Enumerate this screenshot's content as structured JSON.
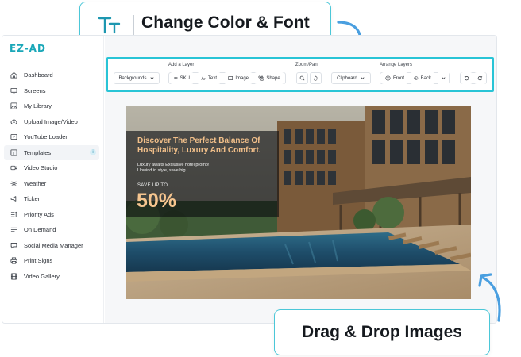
{
  "callouts": {
    "top": "Change Color & Font",
    "bottom": "Drag & Drop Images",
    "top_icon": "text-format-icon"
  },
  "app": {
    "logo": "EZ-AD",
    "brand_color": "#1aa7b8",
    "highlight_color": "#29c4d6"
  },
  "sidebar": {
    "items": [
      {
        "label": "Dashboard",
        "icon": "home-icon"
      },
      {
        "label": "Screens",
        "icon": "monitor-icon"
      },
      {
        "label": "My Library",
        "icon": "image-icon"
      },
      {
        "label": "Upload Image/Video",
        "icon": "cloud-upload-icon"
      },
      {
        "label": "YouTube Loader",
        "icon": "play-box-icon"
      },
      {
        "label": "Templates",
        "icon": "templates-icon",
        "active": true,
        "badge": "i"
      },
      {
        "label": "Video Studio",
        "icon": "video-icon"
      },
      {
        "label": "Weather",
        "icon": "sun-icon"
      },
      {
        "label": "Ticker",
        "icon": "megaphone-icon"
      },
      {
        "label": "Priority Ads",
        "icon": "priority-icon"
      },
      {
        "label": "On Demand",
        "icon": "list-icon"
      },
      {
        "label": "Social Media Manager",
        "icon": "chat-icon"
      },
      {
        "label": "Print Signs",
        "icon": "printer-icon"
      },
      {
        "label": "Video Gallery",
        "icon": "film-icon"
      }
    ]
  },
  "toolbar": {
    "backgrounds": "Backgrounds",
    "add_layer_label": "Add a Layer",
    "sku": "SKU",
    "text": "Text",
    "image": "Image",
    "shape": "Shape",
    "zoom_label": "Zoom/Pan",
    "clipboard": "Clipboard",
    "arrange_label": "Arrange Layers",
    "front": "Front",
    "back": "Back"
  },
  "canvas": {
    "headline": "Discover The Perfect Balance Of Hospitality, Luxury And Comfort.",
    "subtext": "Luxury awaits Exclusive hotel promo! Unwind in style, save big.",
    "save_label": "SAVE UP TO",
    "discount": "50%",
    "accent": "#f2c08a"
  }
}
